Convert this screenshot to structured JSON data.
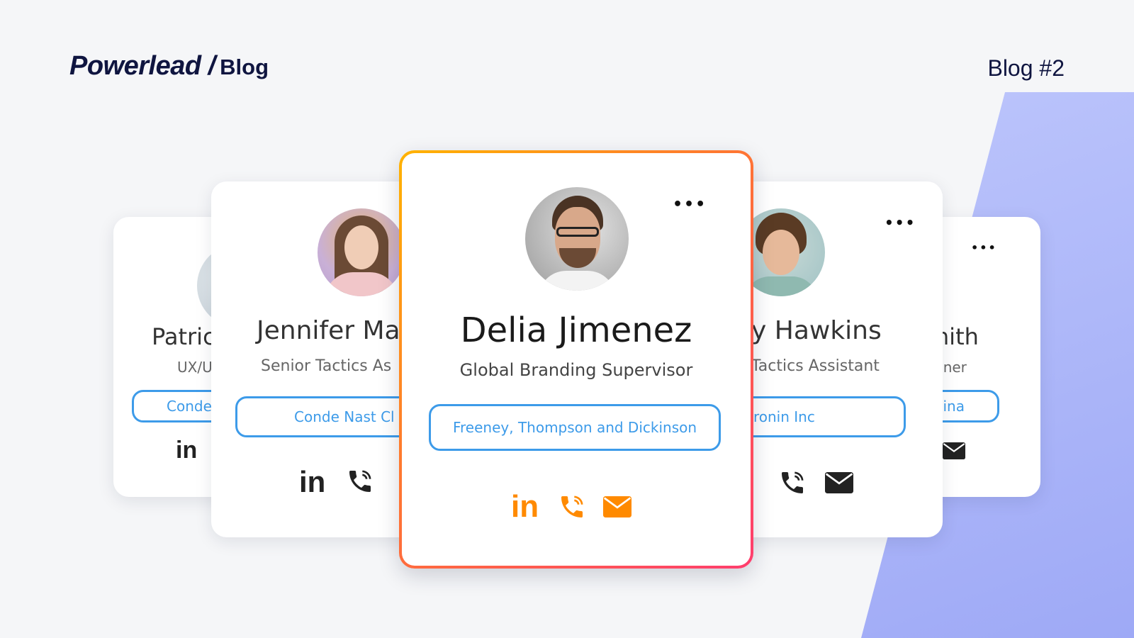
{
  "header": {
    "logo": "Powerlead",
    "slash": "/",
    "section": "Blog",
    "blog_number": "Blog #2"
  },
  "cards": {
    "far_left": {
      "name": "Patric",
      "role": "UX/U",
      "company": "Conde"
    },
    "left": {
      "name": "Jennifer Ma",
      "role": "Senior Tactics As",
      "company": "Conde Nast Cl"
    },
    "main": {
      "name": "Delia Jimenez",
      "role": "Global Branding Supervisor",
      "company": "Freeney, Thompson and Dickinson"
    },
    "right": {
      "name": "y Hawkins",
      "role": "Tactics Assistant",
      "company": "Cronin Inc"
    },
    "far_right": {
      "name": "mith",
      "role": "gner",
      "company": "China"
    }
  },
  "icons": {
    "linkedin": "in",
    "more": "•••"
  },
  "colors": {
    "brand_navy": "#0f1540",
    "company_blue": "#3d9be9",
    "accent_orange": "#ff8a00",
    "icon_dark": "#222222",
    "background": "#f5f6f8"
  }
}
